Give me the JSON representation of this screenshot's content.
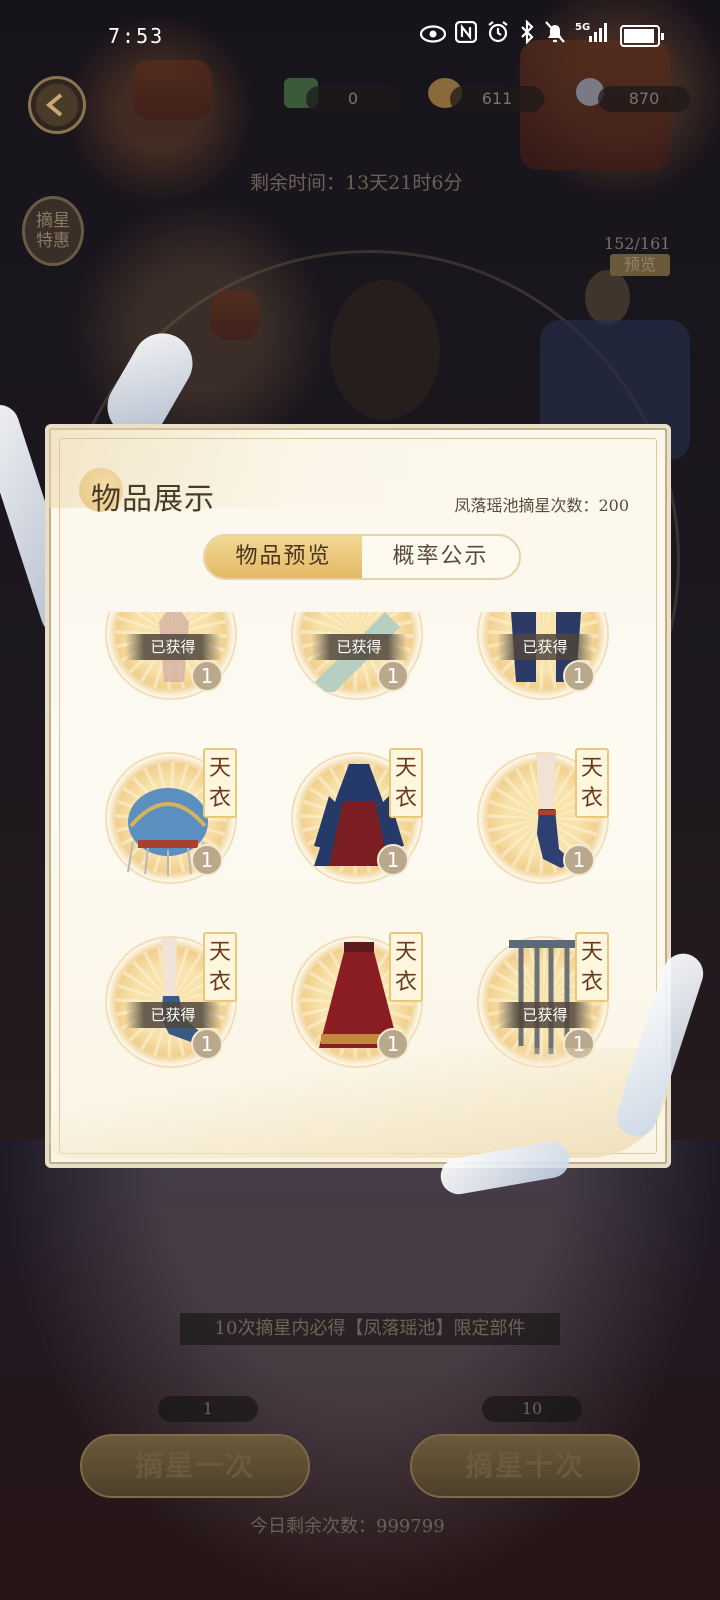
{
  "status_bar": {
    "time": "7:53",
    "icons": [
      "eye-icon",
      "nfc-icon",
      "alarm-icon",
      "bluetooth-icon",
      "mute-icon",
      "signal-5g-icon",
      "battery-icon"
    ]
  },
  "top_bar": {
    "currencies": [
      {
        "icon": "ticket-icon",
        "value": "0"
      },
      {
        "icon": "coin-icon",
        "value": "611"
      },
      {
        "icon": "diamond-icon",
        "value": "870"
      }
    ],
    "remaining_time": "剩余时间：13天21时6分",
    "side_badge": "摘星特惠",
    "preview_count": "152/161",
    "preview_label": "预览"
  },
  "modal": {
    "title": "物品展示",
    "pool_count": "凤落瑶池摘星次数：200",
    "tabs": [
      {
        "label": "物品预览",
        "active": true
      },
      {
        "label": "概率公示",
        "active": false
      }
    ],
    "tag_text": "天衣",
    "obtained_text": "已获得",
    "items": [
      {
        "name": "partial-item-1",
        "qty": "1",
        "obtained": true,
        "tag": false
      },
      {
        "name": "partial-item-2",
        "qty": "1",
        "obtained": true,
        "tag": false
      },
      {
        "name": "partial-item-3",
        "qty": "1",
        "obtained": true,
        "tag": false
      },
      {
        "name": "phoenix-crown",
        "qty": "1",
        "obtained": false,
        "tag": true
      },
      {
        "name": "navy-hanfu-dress",
        "qty": "1",
        "obtained": false,
        "tag": true
      },
      {
        "name": "blue-boot-leg",
        "qty": "1",
        "obtained": false,
        "tag": true
      },
      {
        "name": "blue-shoe-leg",
        "qty": "1",
        "obtained": true,
        "tag": true
      },
      {
        "name": "red-skirt",
        "qty": "1",
        "obtained": false,
        "tag": true
      },
      {
        "name": "hanging-ornament",
        "qty": "1",
        "obtained": true,
        "tag": true
      }
    ]
  },
  "bottom": {
    "guarantee": "10次摘星内必得【凤落瑶池】限定部件",
    "single_cost": "1",
    "ten_cost": "10",
    "single_button": "摘星一次",
    "ten_button": "摘星十次",
    "today_left": "今日剩余次数：999799"
  }
}
